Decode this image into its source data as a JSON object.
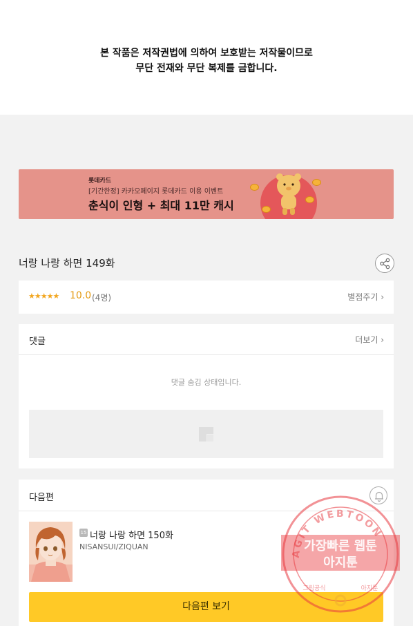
{
  "notice": {
    "line1": "본 작품은 저작권법에 의하여 보호받는 저작물이므로",
    "line2": "무단 전재와 무단 복제를 금합니다."
  },
  "banner": {
    "brand": "롯데카드",
    "subtitle": "[기간한정] 카카오페이지 롯데카드 이용 이벤트",
    "headline": "춘식이 인형 + 최대 11만 캐시",
    "background_color": "#e5938a"
  },
  "episode": {
    "title": "너랑 나랑 하면 149화",
    "share_icon": "share-icon"
  },
  "rating": {
    "stars": "★★★★★",
    "score": "10.0",
    "count": "(4명)",
    "rate_link": "별점주기 ›",
    "star_color": "#f2a61f"
  },
  "comments": {
    "label": "댓글",
    "more": "더보기 ›",
    "hidden_message": "댓글 숨김 상태입니다."
  },
  "next_episode": {
    "label": "다음편",
    "bell_icon": "bell-icon",
    "age_badge": "15",
    "title": "너랑 나랑 하면 150화",
    "authors": "NISANSUI/ZIQUAN",
    "button": "다음편 보기",
    "button_color": "#ffc926"
  },
  "watermark": {
    "ring_text": "AGIT WEBTOON",
    "line1": "가장빠른 웹툰",
    "line2": "아지툰",
    "bottom_left": "그림공식",
    "bottom_right": "아지툰",
    "color": "#e8393f"
  }
}
